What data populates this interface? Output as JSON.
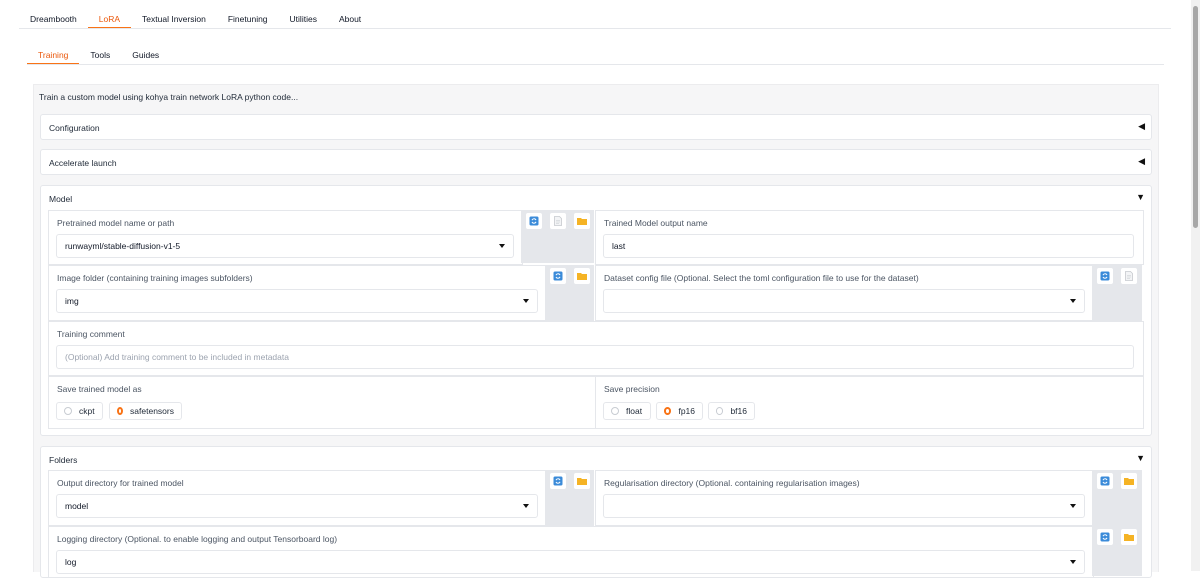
{
  "top_tabs": [
    "Dreambooth",
    "LoRA",
    "Textual Inversion",
    "Finetuning",
    "Utilities",
    "About"
  ],
  "sub_tabs": [
    "Training",
    "Tools",
    "Guides"
  ],
  "description": "Train a custom model using kohya train network LoRA python code...",
  "sections": {
    "configuration": "Configuration",
    "accelerate": "Accelerate launch",
    "model": "Model",
    "folders": "Folders"
  },
  "model": {
    "pretrained_label": "Pretrained model name or path",
    "pretrained_value": "runwayml/stable-diffusion-v1-5",
    "output_name_label": "Trained Model output name",
    "output_name_value": "last",
    "image_folder_label": "Image folder (containing training images subfolders)",
    "image_folder_value": "img",
    "dataset_config_label": "Dataset config file (Optional. Select the toml configuration file to use for the dataset)",
    "dataset_config_value": "",
    "comment_label": "Training comment",
    "comment_placeholder": "(Optional) Add training comment to be included in metadata",
    "save_as_label": "Save trained model as",
    "save_as_options": [
      "ckpt",
      "safetensors"
    ],
    "save_as_selected": "safetensors",
    "precision_label": "Save precision",
    "precision_options": [
      "float",
      "fp16",
      "bf16"
    ],
    "precision_selected": "fp16"
  },
  "folders": {
    "output_dir_label": "Output directory for trained model",
    "output_dir_value": "model",
    "reg_dir_label": "Regularisation directory (Optional. containing regularisation images)",
    "reg_dir_value": "",
    "logging_dir_label": "Logging directory (Optional. to enable logging and output Tensorboard log)",
    "logging_dir_value": "log"
  },
  "icons": {
    "refresh": "refresh-icon",
    "file": "file-icon",
    "folder": "folder-icon",
    "caret_collapsed": "caret-left-icon",
    "caret_expanded": "caret-down-icon"
  },
  "colors": {
    "accent": "#f97316",
    "folder": "#f5b324",
    "refresh": "#3b8bd9"
  }
}
